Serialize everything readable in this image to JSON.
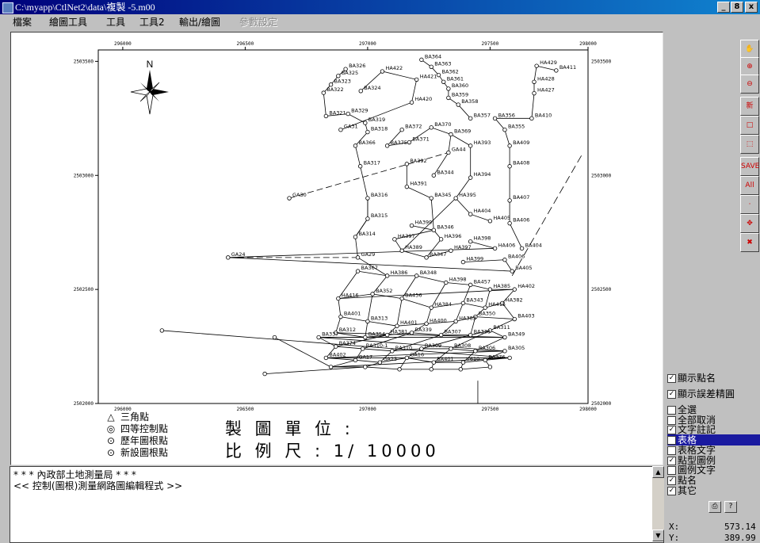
{
  "window": {
    "title": "C:\\myapp\\CtlNet2\\data\\複製 -5.m00",
    "controls": [
      "_",
      "8",
      "x"
    ]
  },
  "menu": {
    "items": [
      "檔案",
      "繪圖工具",
      "工具",
      "工具2",
      "輸出/繪圖"
    ],
    "disabled_item": "參數設定"
  },
  "map": {
    "x_ticks": [
      "296000",
      "296500",
      "297000",
      "297500",
      "298000"
    ],
    "y_ticks": [
      "2503500",
      "2503000",
      "2502500",
      "2502000"
    ],
    "north_label": "N",
    "points": [
      {
        "name": "BA326",
        "x": 296910,
        "y": 2503466
      },
      {
        "name": "BA325",
        "x": 296880,
        "y": 2503436
      },
      {
        "name": "BA323",
        "x": 296850,
        "y": 2503398
      },
      {
        "name": "BA322",
        "x": 296820,
        "y": 2503362
      },
      {
        "name": "BA324",
        "x": 296972,
        "y": 2503370
      },
      {
        "name": "BA364",
        "x": 297220,
        "y": 2503507
      },
      {
        "name": "BA363",
        "x": 297260,
        "y": 2503476
      },
      {
        "name": "BA362",
        "x": 297290,
        "y": 2503440
      },
      {
        "name": "BA361",
        "x": 297310,
        "y": 2503410
      },
      {
        "name": "HA422",
        "x": 297060,
        "y": 2503456
      },
      {
        "name": "HA421",
        "x": 297200,
        "y": 2503420
      },
      {
        "name": "BA360",
        "x": 297330,
        "y": 2503380
      },
      {
        "name": "BA359",
        "x": 297330,
        "y": 2503340
      },
      {
        "name": "BA358",
        "x": 297370,
        "y": 2503310
      },
      {
        "name": "HA420",
        "x": 297180,
        "y": 2503320
      },
      {
        "name": "HA429",
        "x": 297690,
        "y": 2503480
      },
      {
        "name": "BA411",
        "x": 297770,
        "y": 2503460
      },
      {
        "name": "HA428",
        "x": 297680,
        "y": 2503410
      },
      {
        "name": "HA427",
        "x": 297680,
        "y": 2503360
      },
      {
        "name": "BA410",
        "x": 297670,
        "y": 2503250
      },
      {
        "name": "BA321",
        "x": 296830,
        "y": 2503260
      },
      {
        "name": "BA329",
        "x": 296920,
        "y": 2503270
      },
      {
        "name": "BA319",
        "x": 296990,
        "y": 2503230
      },
      {
        "name": "GA31",
        "x": 296890,
        "y": 2503200
      },
      {
        "name": "BA318",
        "x": 297000,
        "y": 2503190
      },
      {
        "name": "BA372",
        "x": 297140,
        "y": 2503200
      },
      {
        "name": "BA370",
        "x": 297260,
        "y": 2503210
      },
      {
        "name": "BA369",
        "x": 297340,
        "y": 2503180
      },
      {
        "name": "BA357",
        "x": 297420,
        "y": 2503250
      },
      {
        "name": "BA356",
        "x": 297520,
        "y": 2503250
      },
      {
        "name": "BA355",
        "x": 297560,
        "y": 2503200
      },
      {
        "name": "BA366",
        "x": 296950,
        "y": 2503130
      },
      {
        "name": "BA373",
        "x": 297080,
        "y": 2503130
      },
      {
        "name": "BA371",
        "x": 297170,
        "y": 2503145
      },
      {
        "name": "HA393",
        "x": 297420,
        "y": 2503130
      },
      {
        "name": "GA44",
        "x": 297330,
        "y": 2503100
      },
      {
        "name": "BA409",
        "x": 297580,
        "y": 2503130
      },
      {
        "name": "BA317",
        "x": 296970,
        "y": 2503040
      },
      {
        "name": "BA392",
        "x": 297160,
        "y": 2503050
      },
      {
        "name": "BA344",
        "x": 297270,
        "y": 2503000
      },
      {
        "name": "HA394",
        "x": 297420,
        "y": 2502990
      },
      {
        "name": "BA408",
        "x": 297580,
        "y": 2503040
      },
      {
        "name": "GA30",
        "x": 296680,
        "y": 2502900
      },
      {
        "name": "HA391",
        "x": 297160,
        "y": 2502950
      },
      {
        "name": "BA345",
        "x": 297260,
        "y": 2502900
      },
      {
        "name": "BA316",
        "x": 297000,
        "y": 2502900
      },
      {
        "name": "HA395",
        "x": 297360,
        "y": 2502900
      },
      {
        "name": "BA407",
        "x": 297580,
        "y": 2502890
      },
      {
        "name": "HA404",
        "x": 297420,
        "y": 2502830
      },
      {
        "name": "BA315",
        "x": 297000,
        "y": 2502810
      },
      {
        "name": "HA399",
        "x": 297180,
        "y": 2502780
      },
      {
        "name": "BA346",
        "x": 297270,
        "y": 2502760
      },
      {
        "name": "HA405",
        "x": 297500,
        "y": 2502800
      },
      {
        "name": "BA406",
        "x": 297580,
        "y": 2502790
      },
      {
        "name": "BA314",
        "x": 296950,
        "y": 2502730
      },
      {
        "name": "HA397",
        "x": 297110,
        "y": 2502720
      },
      {
        "name": "HA396",
        "x": 297300,
        "y": 2502720
      },
      {
        "name": "HA398",
        "x": 297420,
        "y": 2502710
      },
      {
        "name": "HA406",
        "x": 297520,
        "y": 2502680
      },
      {
        "name": "BA404",
        "x": 297630,
        "y": 2502680
      },
      {
        "name": "GA24",
        "x": 296430,
        "y": 2502640
      },
      {
        "name": "GA29",
        "x": 296960,
        "y": 2502640
      },
      {
        "name": "HA389",
        "x": 297140,
        "y": 2502670
      },
      {
        "name": "BA347",
        "x": 297240,
        "y": 2502640
      },
      {
        "name": "HA397b",
        "x": 297340,
        "y": 2502670
      },
      {
        "name": "HA399b",
        "x": 297390,
        "y": 2502620
      },
      {
        "name": "BA406b",
        "x": 297560,
        "y": 2502630
      },
      {
        "name": "BA405",
        "x": 297590,
        "y": 2502580
      }
    ],
    "point_labels": [
      "BA326",
      "BA325",
      "BA323",
      "BA322",
      "BA324",
      "BA364",
      "BA363",
      "BA362",
      "BA361",
      "HA422",
      "HA421",
      "BA360",
      "BA359",
      "BA358",
      "HA420",
      "HA429",
      "BA411",
      "HA428",
      "HA427",
      "BA410",
      "BA321",
      "BA329",
      "BA319",
      "GA31",
      "BA318",
      "BA372",
      "BA370",
      "BA369",
      "BA357",
      "BA356",
      "BA355",
      "BA366",
      "BA375",
      "BA371",
      "HA393",
      "GA44",
      "BA409",
      "BA317",
      "BA392",
      "BA344",
      "HA394",
      "BA408",
      "GA30",
      "HA391",
      "BA345",
      "BA316",
      "HA395",
      "BA407",
      "HA404",
      "BA315",
      "HA399",
      "BA346",
      "HA405",
      "BA406",
      "BA314",
      "HA397",
      "HA396",
      "HA398",
      "HA406",
      "BA404",
      "GA24",
      "GA29",
      "HA389",
      "BA347",
      "HA397",
      "HA399",
      "BA406",
      "BA405",
      "BA367",
      "HA386",
      "BA348",
      "HA398",
      "BA457",
      "HA385",
      "HA402",
      "HA416",
      "BA352",
      "BA456",
      "HA384",
      "BA343",
      "HA415",
      "HA382",
      "BA401",
      "BA313",
      "HA401",
      "HA400",
      "HA383",
      "BA350",
      "BA403",
      "BA312",
      "BA354",
      "HA381",
      "BA339",
      "BA307",
      "BA338",
      "BA311",
      "BA349",
      "BA337",
      "BA374",
      "BA310-1",
      "BA310",
      "BA309",
      "BA308",
      "BA306",
      "BA305",
      "BA402",
      "GA17",
      "GA23",
      "GA16",
      "BA401",
      "V610",
      "BA376"
    ]
  },
  "legend": {
    "items": [
      {
        "symbol": "△",
        "label": "三角點"
      },
      {
        "symbol": "◎",
        "label": "四等控制點"
      },
      {
        "symbol": "⊙",
        "label": "歷年圖根點"
      },
      {
        "symbol": "⊙",
        "label": "新設圖根點"
      }
    ]
  },
  "titleblock": {
    "unit_label": "製 圖 單 位 :",
    "scale_label": "比 例 尺 : 1/ 10000"
  },
  "toolbar": {
    "buttons": [
      "hand-icon",
      "zoom-in-icon",
      "zoom-out-icon",
      "new-icon",
      "rect-icon",
      "select-rect-icon",
      "save-icon",
      "all-icon",
      "point-icon",
      "move-icon",
      "delete-icon"
    ],
    "labels": {
      "new": "新",
      "save": "SAVE",
      "all": "All"
    }
  },
  "options": {
    "items": [
      {
        "label": "顯示點名",
        "checked": true
      },
      {
        "label": "顯示誤差精圓",
        "checked": true
      },
      {
        "label": "全選",
        "checked": false
      },
      {
        "label": "全部取消",
        "checked": false
      },
      {
        "label": "文字註記",
        "checked": true
      },
      {
        "label": "表格",
        "checked": true,
        "selected": true
      },
      {
        "label": "表格文字",
        "checked": false
      },
      {
        "label": "點型圖例",
        "checked": true
      },
      {
        "label": "圖例文字",
        "checked": false
      },
      {
        "label": "點名",
        "checked": true
      },
      {
        "label": "其它",
        "checked": true
      }
    ]
  },
  "console": {
    "line1": "* * * 內政部土地測量局 * * *",
    "line2": "<< 控制(圖根)測量網路圖編輯程式 >>"
  },
  "coords": {
    "x_label": "X:",
    "x_value": "573.14",
    "y_label": "Y:",
    "y_value": "389.99"
  },
  "colors": {
    "titlebar": "#00007b",
    "selection": "#1a1aa0",
    "face": "#c0c0c0"
  }
}
